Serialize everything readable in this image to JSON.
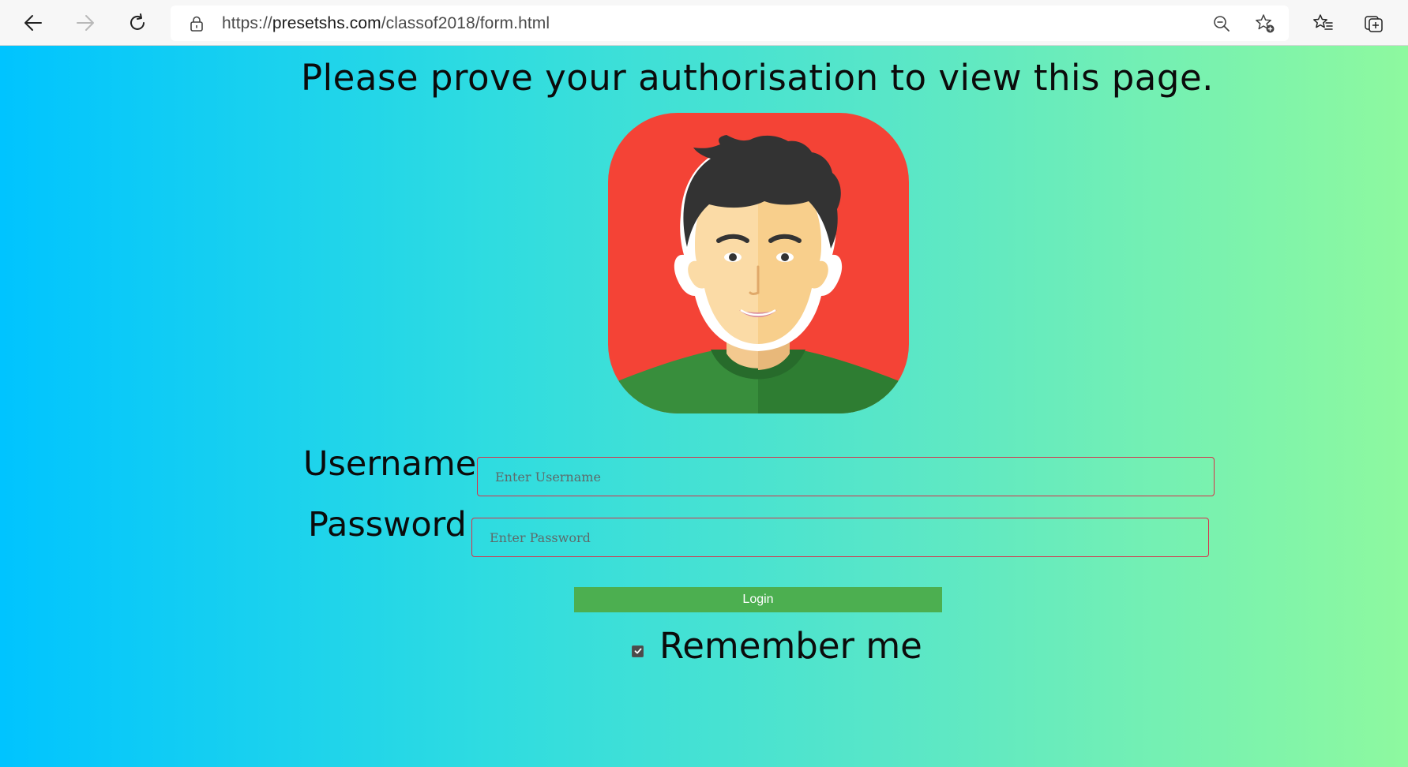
{
  "browser": {
    "url_scheme": "https://",
    "url_host": "presetshs.com",
    "url_path": "/classof2018/form.html",
    "icons": {
      "back": "back-arrow-icon",
      "forward": "forward-arrow-icon",
      "refresh": "refresh-icon",
      "lock": "lock-icon",
      "zoom": "zoom-out-icon",
      "add_favorite": "add-favorite-icon",
      "favorites": "favorites-icon",
      "collections": "collections-icon"
    }
  },
  "page": {
    "heading": "Please prove your authorisation to view this page.",
    "avatar_icon": "user-avatar-icon",
    "colors": {
      "gradient_start": "#00c4ff",
      "gradient_end": "#8ef99f",
      "avatar_bg": "#f44336",
      "login_bg": "#4caf50",
      "field_border": "#d6314a"
    }
  },
  "form": {
    "username_label": "Username",
    "username_placeholder": "Enter Username",
    "username_value": "",
    "password_label": "Password",
    "password_placeholder": "Enter Password",
    "password_value": "",
    "login_label": "Login",
    "remember_label": "Remember me",
    "remember_checked": true
  }
}
